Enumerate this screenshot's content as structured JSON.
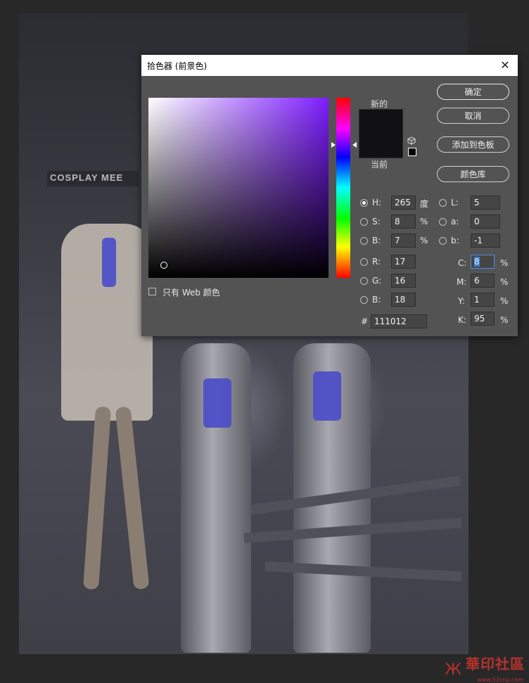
{
  "background": {
    "banner_text": "COSPLAY MEE"
  },
  "dialog": {
    "title": "拾色器 (前景色)",
    "close_glyph": "✕",
    "new_label": "新的",
    "current_label": "当前",
    "new_color": "#111012",
    "current_color": "#111012",
    "selected_hue_color": "#7d1dff",
    "buttons": {
      "ok": "确定",
      "cancel": "取消",
      "add_to_swatches": "添加到色板",
      "color_libraries": "颜色库"
    },
    "web_only_label": "只有 Web 颜色",
    "hsb": {
      "h": {
        "label": "H:",
        "value": "265",
        "unit": "度",
        "selected": true
      },
      "s": {
        "label": "S:",
        "value": "8",
        "unit": "%"
      },
      "b": {
        "label": "B:",
        "value": "7",
        "unit": "%"
      }
    },
    "rgb": {
      "r": {
        "label": "R:",
        "value": "17"
      },
      "g": {
        "label": "G:",
        "value": "16"
      },
      "b": {
        "label": "B:",
        "value": "18"
      }
    },
    "lab": {
      "l": {
        "label": "L:",
        "value": "5"
      },
      "a": {
        "label": "a:",
        "value": "0"
      },
      "b": {
        "label": "b:",
        "value": "-1"
      }
    },
    "cmyk": {
      "c": {
        "label": "C:",
        "value": "8",
        "unit": "%"
      },
      "m": {
        "label": "M:",
        "value": "6",
        "unit": "%"
      },
      "y": {
        "label": "Y:",
        "value": "1",
        "unit": "%"
      },
      "k": {
        "label": "K:",
        "value": "95",
        "unit": "%"
      }
    },
    "hex": {
      "label": "#",
      "value": "111012"
    }
  },
  "watermark": {
    "logo": "Ж",
    "text": "華印社區",
    "url": "www.52cnp.com"
  }
}
